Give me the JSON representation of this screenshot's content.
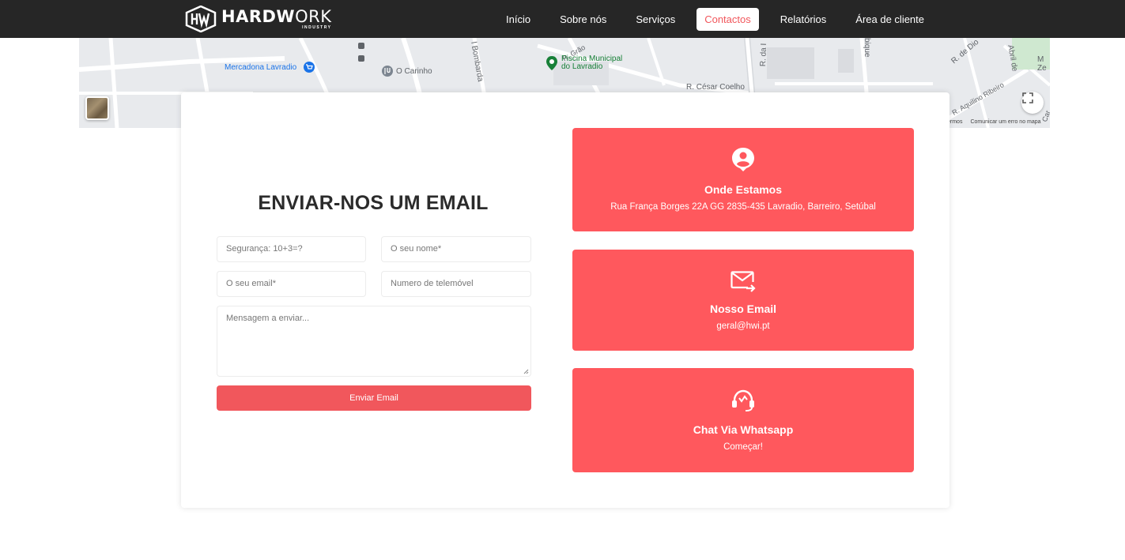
{
  "brand": {
    "name_bold": "HARDW",
    "name_light": "ORK",
    "sub": "INDUSTRY",
    "mark": "HW"
  },
  "nav": [
    {
      "label": "Início"
    },
    {
      "label": "Sobre nós"
    },
    {
      "label": "Serviços"
    },
    {
      "label": "Contactos",
      "active": true
    },
    {
      "label": "Relatórios"
    },
    {
      "label": "Área de cliente"
    }
  ],
  "map": {
    "labels": {
      "mercadona": "Mercadona Lavradio",
      "carinho": "O Carinho",
      "bombarda": "l Bombarda",
      "grao": "R. Grão",
      "piscina_1": "Piscina Municipal",
      "piscina_2": "do Lavradio",
      "cesar": "R. César Coelho",
      "dai": "R. da I",
      "bique": "bique",
      "dio": "R. de Dio",
      "abril": "Abril de",
      "aquilino": "R. Aquilino Ribeiro",
      "ze": "Ze",
      "m": "M",
      "car": "Car"
    },
    "footer_terms": "ermos",
    "footer_report": "Comunicar um erro no mapa"
  },
  "form": {
    "title": "ENVIAR-NOS UM EMAIL",
    "security_placeholder": "Segurança: 10+3=?",
    "name_placeholder": "O seu nome*",
    "email_placeholder": "O seu email*",
    "phone_placeholder": "Numero de telemóvel",
    "message_placeholder": "Mensagem a enviar...",
    "submit_label": "Enviar Email"
  },
  "info_cards": {
    "location": {
      "title": "Onde Estamos",
      "text": "Rua França Borges 22A GG 2835-435 Lavradio, Barreiro, Setúbal",
      "icon": "location-person-icon"
    },
    "email": {
      "title": "Nosso Email",
      "text": "geral@hwi.pt",
      "icon": "mail-send-icon"
    },
    "whatsapp": {
      "title": "Chat Via Whatsapp",
      "text": "Começar!",
      "icon": "support-headset-icon"
    }
  },
  "colors": {
    "accent": "#ff585d",
    "nav_bg": "#262626"
  }
}
